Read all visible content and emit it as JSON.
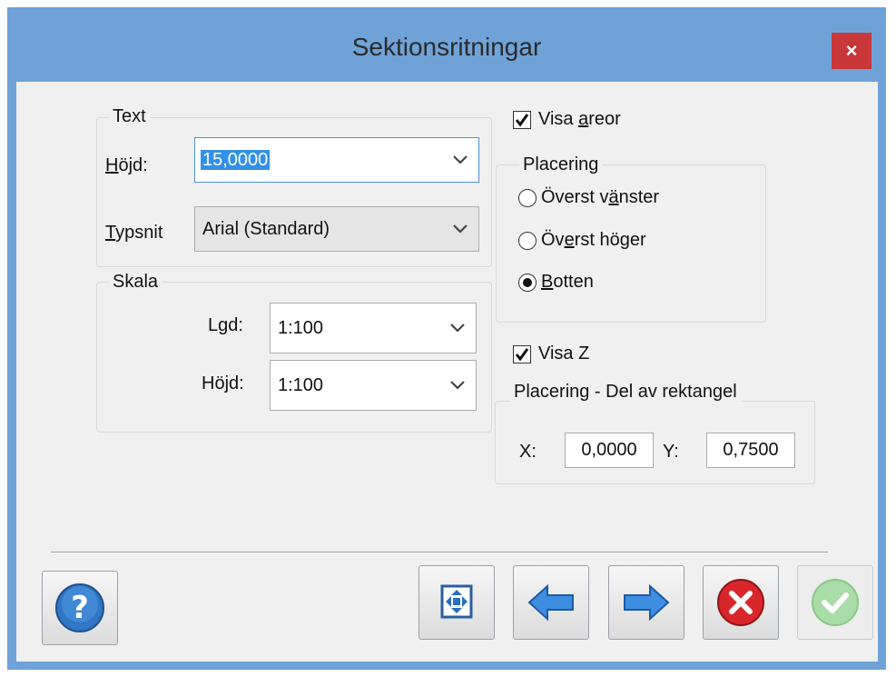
{
  "window": {
    "title": "Sektionsritningar",
    "close_glyph": "×"
  },
  "text_group": {
    "legend": "Text",
    "height_label": "Höjd:",
    "height_value": "15,0000",
    "font_label": "Typsnit",
    "font_value": "Arial (Standard)"
  },
  "scale_group": {
    "legend": "Skala",
    "length_label": "Lgd:",
    "length_value": "1:100",
    "height_label": "Höjd:",
    "height_value": "1:100"
  },
  "areas": {
    "checkbox_label": "Visa areor",
    "checked": true,
    "placement_legend": "Placering",
    "options": [
      {
        "label": "Överst vänster",
        "selected": false
      },
      {
        "label": "Överst höger",
        "selected": false
      },
      {
        "label": "Botten",
        "selected": true
      }
    ]
  },
  "z": {
    "checkbox_label": "Visa Z",
    "checked": true,
    "placement_legend": "Placering - Del av rektangel",
    "x_label": "X:",
    "x_value": "0,0000",
    "y_label": "Y:",
    "y_value": "0,7500"
  },
  "buttons": {
    "help": "help-icon",
    "fit": "fit-frame-icon",
    "back": "arrow-left-icon",
    "forward": "arrow-right-icon",
    "cancel": "cancel-icon",
    "ok": "ok-icon"
  },
  "colors": {
    "accent": "#6fa3d8",
    "close": "#c9373a",
    "selection": "#3390e8"
  }
}
